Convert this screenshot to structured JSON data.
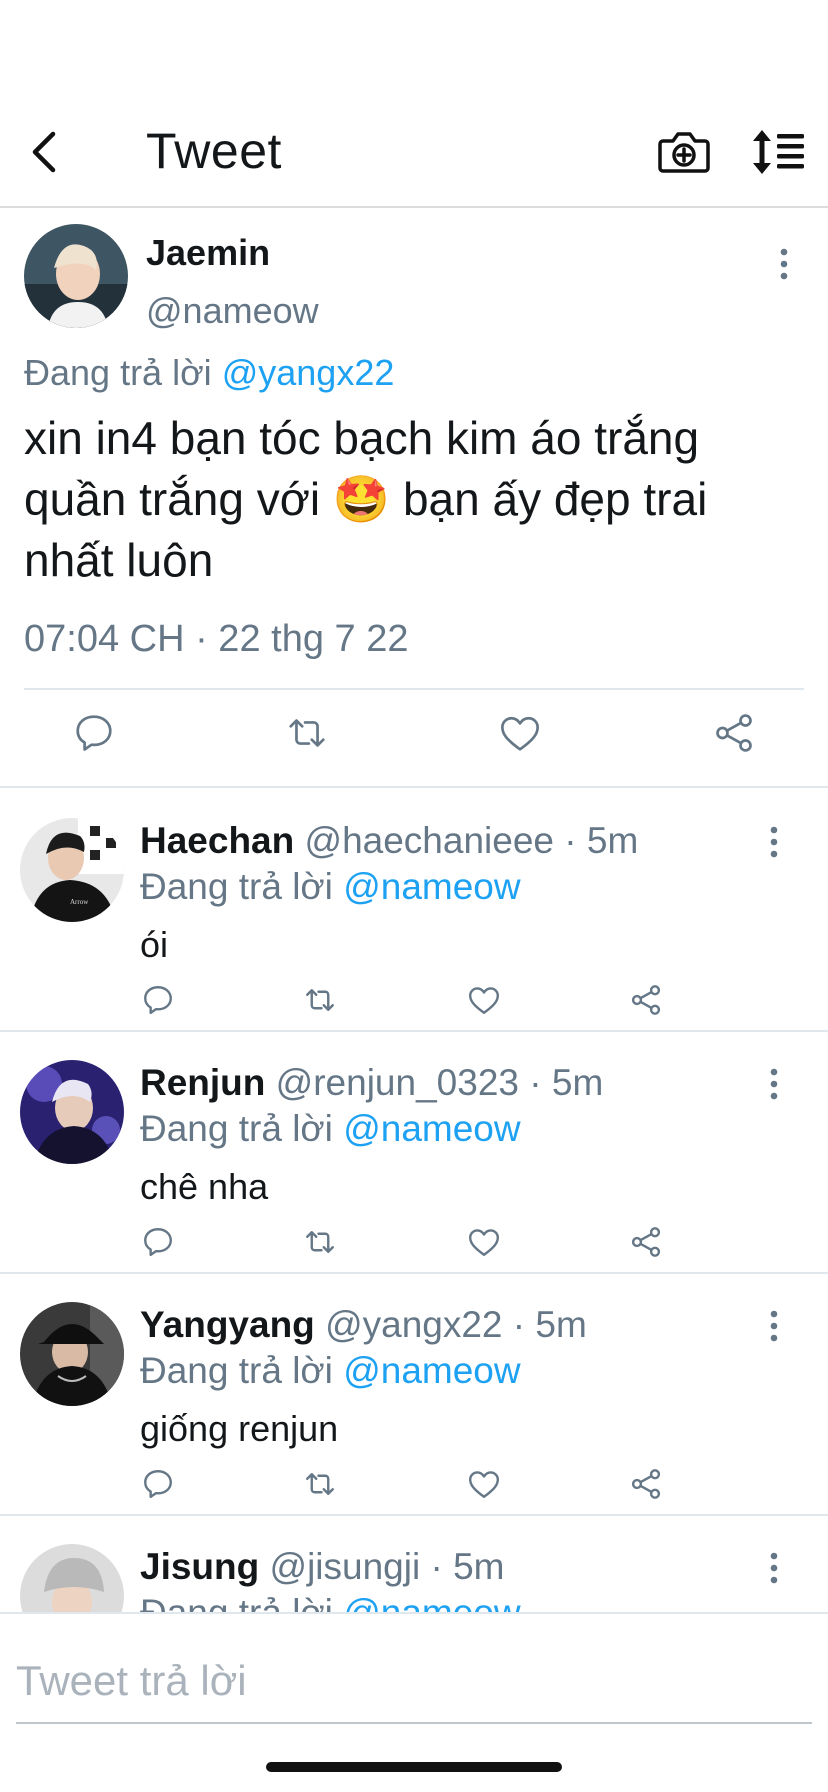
{
  "header": {
    "title": "Tweet",
    "back_icon": "chevron-left-icon",
    "camera_icon": "camera-plus-icon",
    "sort_icon": "sort-list-icon"
  },
  "main_tweet": {
    "author_name": "Jaemin",
    "author_handle": "@nameow",
    "replying_prefix": "Đang trả lời",
    "replying_to": "@yangx22",
    "text": "xin in4 bạn tóc bạch kim áo trắng quần trắng với 🤩 bạn ấy đẹp trai nhất luôn",
    "timestamp": "07:04 CH · 22 thg 7 22"
  },
  "replies": [
    {
      "name": "Haechan",
      "handle": "@haechanieee",
      "time": "· 5m",
      "replying_prefix": "Đang trả lời",
      "replying_to": "@nameow",
      "text": "ói"
    },
    {
      "name": "Renjun",
      "handle": "@renjun_0323",
      "time": "· 5m",
      "replying_prefix": "Đang trả lời",
      "replying_to": "@nameow",
      "text": "chê nha"
    },
    {
      "name": "Yangyang",
      "handle": "@yangx22",
      "time": "· 5m",
      "replying_prefix": "Đang trả lời",
      "replying_to": "@nameow",
      "text": "giống renjun"
    },
    {
      "name": "Jisung",
      "handle": "@jisungji",
      "time": "· 5m",
      "replying_prefix": "Đang trả lời",
      "replying_to": "@nameow",
      "text": ""
    }
  ],
  "composer": {
    "placeholder": "Tweet trả lời"
  },
  "colors": {
    "accent": "#1da1f2",
    "secondary_text": "#657786",
    "divider": "#e1e8ed"
  }
}
